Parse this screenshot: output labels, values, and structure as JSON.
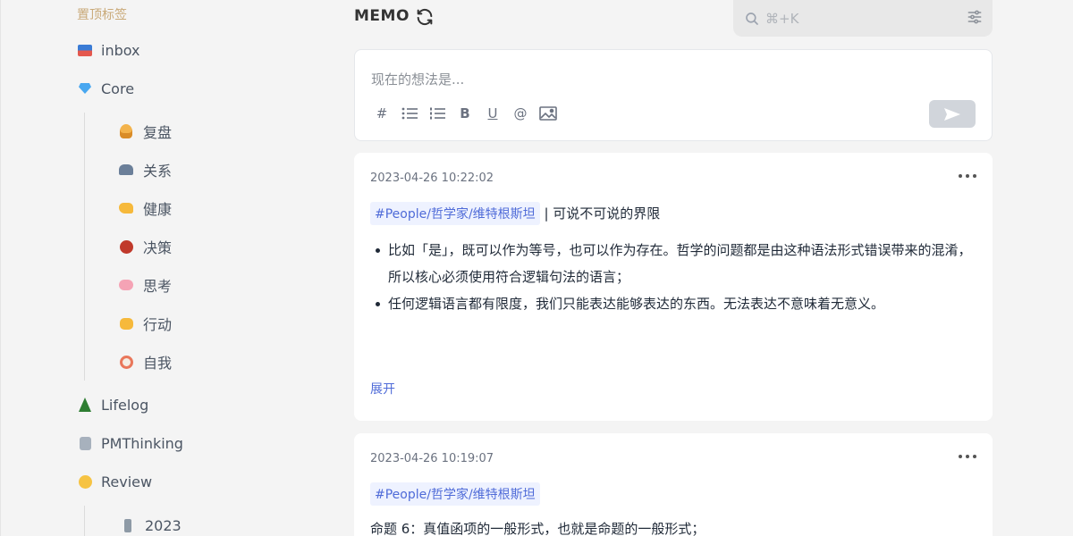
{
  "sidebar": {
    "pinned_title": "置顶标签",
    "items": [
      {
        "label": "inbox",
        "icon": "inbox-tray-icon"
      },
      {
        "label": "Core",
        "icon": "gem-icon"
      },
      {
        "label": "复盘",
        "icon": "person-icon"
      },
      {
        "label": "关系",
        "icon": "people-icon"
      },
      {
        "label": "健康",
        "icon": "flexed-arm-icon"
      },
      {
        "label": "决策",
        "icon": "ogre-face-icon"
      },
      {
        "label": "思考",
        "icon": "brain-icon"
      },
      {
        "label": "行动",
        "icon": "fist-icon"
      },
      {
        "label": "自我",
        "icon": "clown-face-icon"
      },
      {
        "label": "Lifelog",
        "icon": "tree-icon"
      },
      {
        "label": "PMThinking",
        "icon": "robot-icon"
      },
      {
        "label": "Review",
        "icon": "thinking-face-icon"
      },
      {
        "label": "2023",
        "icon": "microscope-icon"
      }
    ]
  },
  "header": {
    "title": "MEMO",
    "search_placeholder": "⌘+K"
  },
  "editor": {
    "placeholder": "现在的想法是...",
    "tools": [
      "#",
      "list",
      "ordered-list",
      "B",
      "U",
      "@",
      "image"
    ]
  },
  "memos": [
    {
      "time": "2023-04-26 10:22:02",
      "tag": "#People/哲学家/维特根斯坦",
      "title_rest": "| 可说不可说的界限",
      "bullets": [
        "比如「是」，既可以作为等号，也可以作为存在。哲学的问题都是由这种语法形式错误带来的混淆，所以核心必须使用符合逻辑句法的语言；",
        "任何逻辑语言都有限度，我们只能表达能够表达的东西。无法表达不意味着无意义。"
      ],
      "expand_label": "展开"
    },
    {
      "time": "2023-04-26 10:19:07",
      "tag": "#People/哲学家/维特根斯坦",
      "text": "命题 6：真值函项的一般形式，也就是命题的一般形式；"
    }
  ]
}
